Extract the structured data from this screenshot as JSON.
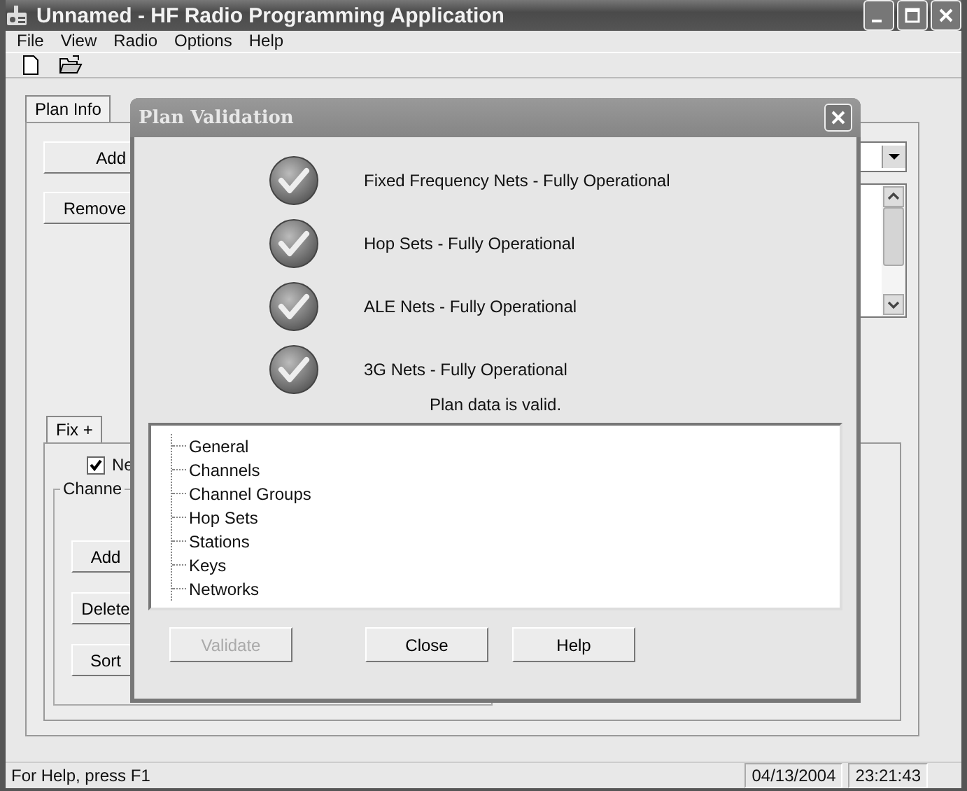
{
  "window": {
    "title": "Unnamed - HF Radio Programming Application"
  },
  "menu": [
    "File",
    "View",
    "Radio",
    "Options",
    "Help"
  ],
  "main_tabs": [
    {
      "label": "Plan Info",
      "selected": true
    }
  ],
  "plan_buttons": [
    "Add",
    "Remove"
  ],
  "sub_tabs": [
    {
      "label": "Fix +",
      "selected": true
    }
  ],
  "checkbox": {
    "label": "Ne",
    "checked": true
  },
  "group_label": "Channe",
  "channel_buttons": [
    "Add",
    "Delete",
    "Sort"
  ],
  "dialog": {
    "title": "Plan Validation",
    "results": [
      {
        "label": "Fixed Frequency Nets - Fully Operational",
        "kind": "check"
      },
      {
        "label": "Hop Sets - Fully Operational",
        "kind": "check"
      },
      {
        "label": "ALE Nets - Fully Operational",
        "kind": "check"
      },
      {
        "label": "3G Nets - Fully Operational",
        "kind": "check"
      }
    ],
    "message": "Plan data is valid.",
    "tree": [
      "General",
      "Channels",
      "Channel Groups",
      "Hop Sets",
      "Stations",
      "Keys",
      "Networks"
    ],
    "buttons": [
      {
        "label": "Validate",
        "disabled": true
      },
      {
        "label": "Close",
        "disabled": false
      },
      {
        "label": "Help",
        "disabled": false
      }
    ]
  },
  "status_bar": {
    "text": "For Help, press F1",
    "date": "04/13/2004",
    "time": "23:21:43"
  }
}
